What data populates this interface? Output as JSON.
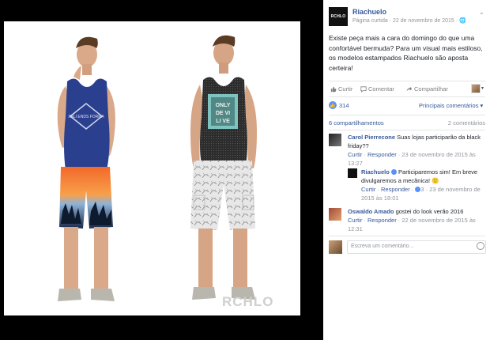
{
  "photo": {
    "watermark": "RCHLO",
    "left_shirt_print": "XALI ENDS FORMA"
  },
  "page": {
    "logo_text": "RCHLO",
    "name": "Riachuelo",
    "meta": "Página curtida · 22 de novembro de 2015 · ",
    "chevron": "⌄"
  },
  "post": {
    "text": "Existe peça mais a cara do domingo do que uma confortável bermuda? Para um visual mais estiloso, os modelos estampados Riachuelo são aposta certeira!"
  },
  "actions": {
    "like": "Curtir",
    "comment": "Comentar",
    "share": "Compartilhar",
    "caret": "▾"
  },
  "reactions": {
    "count": "314",
    "top_comments": "Principais comentários ▾"
  },
  "counts": {
    "shares": "6 compartilhamentos",
    "comments": "2 comentários"
  },
  "comments": [
    {
      "name": "Carol Pierrecone",
      "text": " Suas lojas participarão da black friday??",
      "like": "Curtir",
      "reply": "Responder",
      "date": " · 23 de novembro de 2015 às 13:27"
    },
    {
      "name": "Riachuelo",
      "text": " Participaremos sim! Em breve divulgaremos a mecânica! 🙂",
      "like": "Curtir",
      "reply": "Responder",
      "likes": "3",
      "date": " · 23 de novembro de 2015 às 18:01"
    },
    {
      "name": "Oswaldo Amado",
      "text": " gostei do look verão 2016",
      "like": "Curtir",
      "reply": "Responder",
      "date": " · 22 de novembro de 2015 às 12:31"
    }
  ],
  "composer": {
    "placeholder": "Escreva um comentário..."
  },
  "colors": {
    "link": "#365899",
    "like_blue": "#5890ff",
    "shorts_left_top": "#f06a2a",
    "tank_left": "#2b3f8f"
  }
}
